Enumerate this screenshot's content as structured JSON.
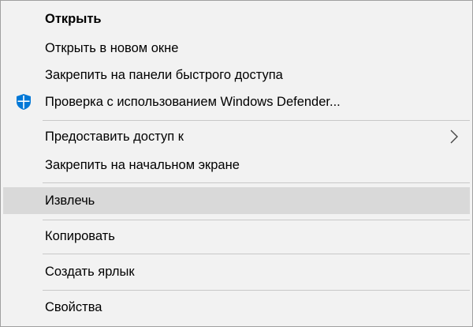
{
  "menu": {
    "items": [
      {
        "label": "Открыть"
      },
      {
        "label": "Открыть в новом окне"
      },
      {
        "label": "Закрепить на панели быстрого доступа"
      },
      {
        "label": "Проверка с использованием Windows Defender...",
        "icon": "windows-defender-shield-icon"
      },
      {
        "label": "Предоставить доступ к",
        "submenu_icon": "chevron-right-icon"
      },
      {
        "label": "Закрепить на начальном экране"
      },
      {
        "label": "Извлечь",
        "highlighted": true
      },
      {
        "label": "Копировать"
      },
      {
        "label": "Создать ярлык"
      },
      {
        "label": "Свойства"
      }
    ]
  },
  "colors": {
    "menu_background": "#f2f2f2",
    "highlight": "#d9d9d9",
    "separator": "#c8c8c8",
    "defender_blue": "#0078d7"
  }
}
